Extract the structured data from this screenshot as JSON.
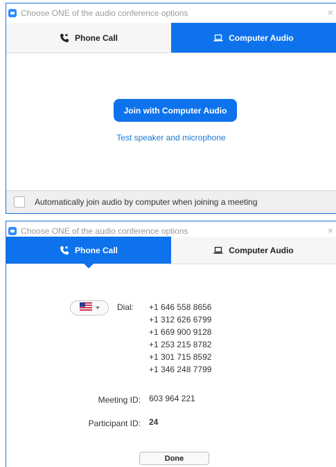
{
  "colors": {
    "accent": "#0e72ed",
    "link": "#1b75d0",
    "title_text": "#9a9a9a"
  },
  "window1": {
    "title": "Choose ONE of the audio conference options",
    "close_glyph": "×",
    "tabs": [
      {
        "label": "Phone Call",
        "icon": "phone-icon",
        "active": false
      },
      {
        "label": "Computer Audio",
        "icon": "laptop-icon",
        "active": true
      }
    ],
    "join_button": "Join with Computer Audio",
    "test_link": "Test speaker and microphone",
    "auto_join_label": "Automatically join audio by computer when joining a meeting",
    "auto_join_checked": false
  },
  "window2": {
    "title": "Choose ONE of the audio conference options",
    "close_glyph": "×",
    "tabs": [
      {
        "label": "Phone Call",
        "icon": "phone-icon",
        "active": true
      },
      {
        "label": "Computer Audio",
        "icon": "laptop-icon",
        "active": false
      }
    ],
    "country_flag": "us-flag-icon",
    "dial_label": "Dial:",
    "dial_numbers": [
      "+1 646 558 8656",
      "+1 312 626 6799",
      "+1 669 900 9128",
      "+1 253 215 8782",
      "+1 301 715 8592",
      "+1 346 248 7799"
    ],
    "meeting_id_label": "Meeting ID:",
    "meeting_id": "603 964 221",
    "participant_id_label": "Participant ID:",
    "participant_id": "24",
    "done_button": "Done"
  }
}
